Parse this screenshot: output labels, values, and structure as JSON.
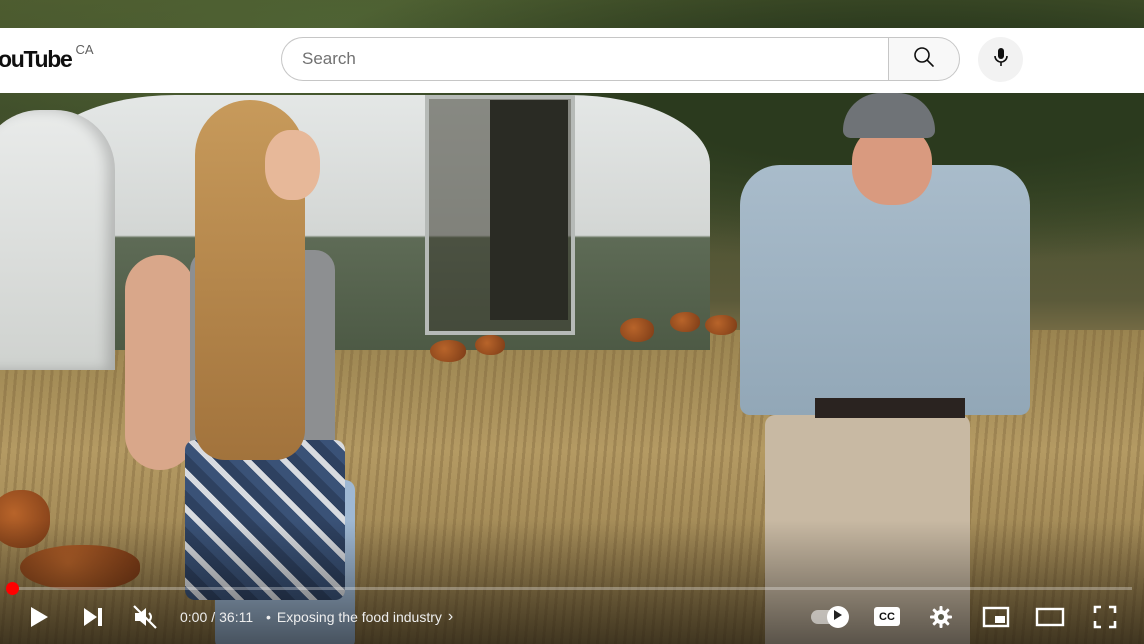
{
  "header": {
    "logo_text": "ouTube",
    "country_code": "CA",
    "search": {
      "placeholder": "Search",
      "value": ""
    },
    "icons": {
      "search": "search-icon",
      "mic": "microphone-icon"
    }
  },
  "player": {
    "progress_fraction": 0,
    "time_current": "0:00",
    "time_separator": "/",
    "time_total": "36:11",
    "chapter_dot": "•",
    "chapter_title": "Exposing the food industry",
    "chapter_chevron": "›",
    "autoplay_on": true,
    "cc_label": "CC",
    "icons": {
      "play": "play-icon",
      "next": "next-icon",
      "mute": "muted-volume-icon",
      "autoplay": "autoplay-toggle",
      "captions": "captions-icon",
      "settings": "gear-icon",
      "miniplayer": "miniplayer-icon",
      "theater": "theater-mode-icon",
      "fullscreen": "fullscreen-icon"
    },
    "colors": {
      "progress": "#ff0000",
      "control": "#ffffff"
    }
  }
}
